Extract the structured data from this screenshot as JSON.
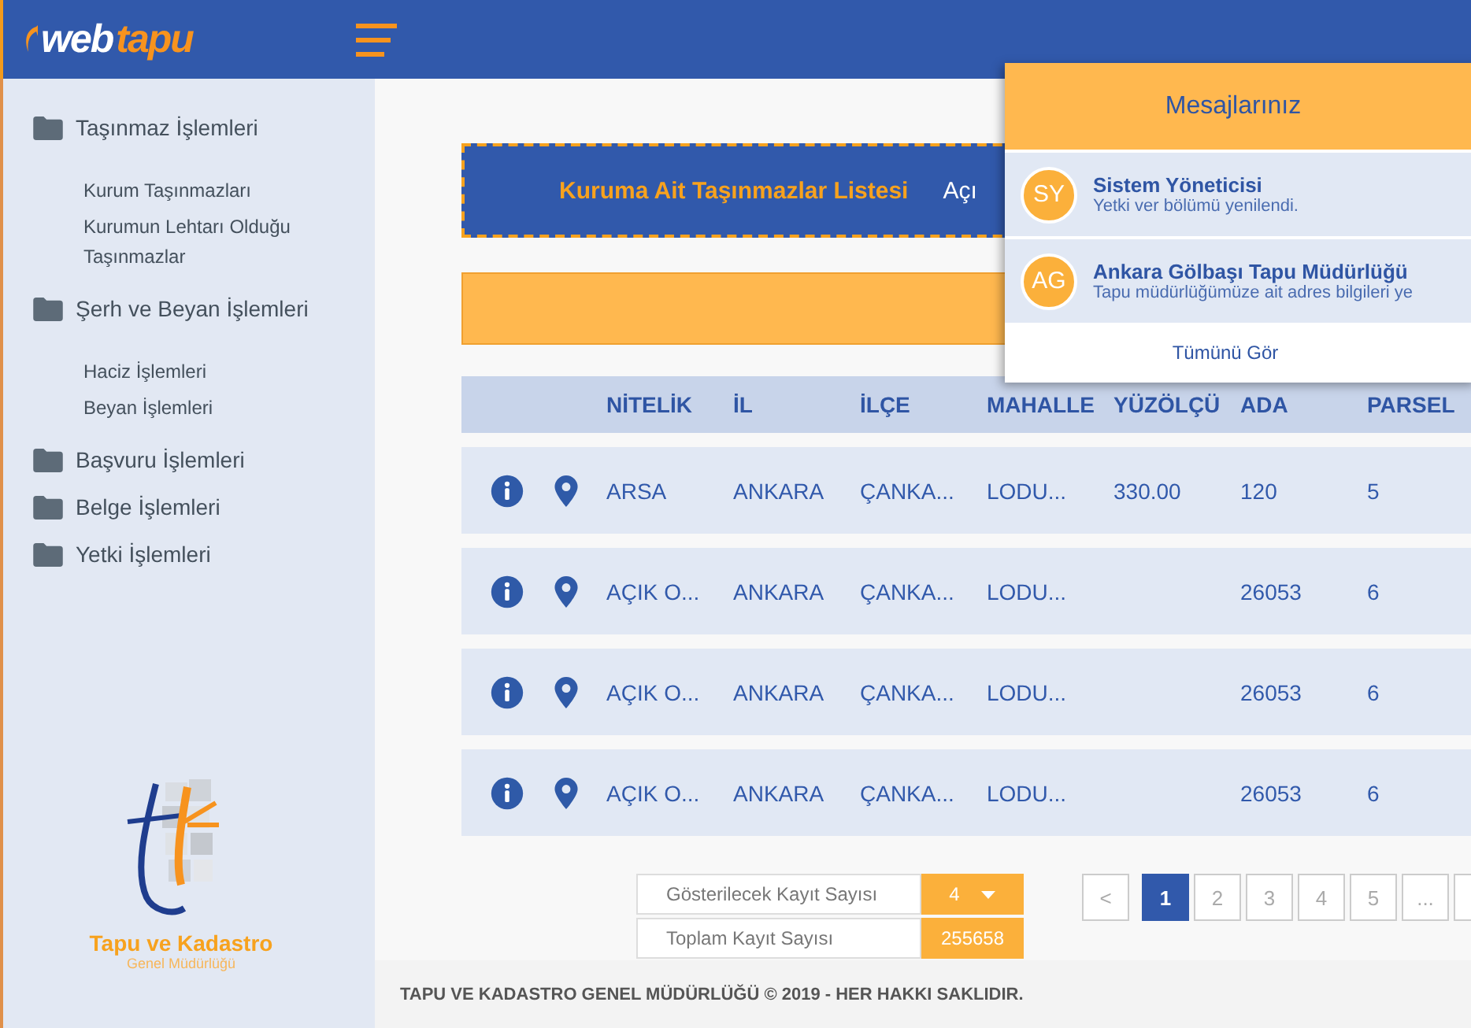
{
  "header": {
    "logo": {
      "part_1": "web",
      "part_2": "tapu"
    }
  },
  "sidebar": {
    "groups": [
      {
        "label": "Taşınmaz İşlemleri",
        "children": [
          {
            "label": "Kurum Taşınmazları"
          },
          {
            "label": "Kurumun Lehtarı Olduğu Taşınmazlar"
          }
        ]
      },
      {
        "label": "Şerh ve Beyan İşlemleri",
        "children": [
          {
            "label": "Haciz İşlemleri"
          },
          {
            "label": "Beyan İşlemleri"
          }
        ]
      },
      {
        "label": "Başvuru İşlemleri"
      },
      {
        "label": "Belge İşlemleri"
      },
      {
        "label": "Yetki İşlemleri"
      }
    ],
    "brand": {
      "title": "Tapu ve Kadastro",
      "subtitle": "Genel Müdürlüğü"
    }
  },
  "banner": {
    "title": "Kuruma Ait Taşınmazlar Listesi",
    "text": "Açı"
  },
  "table": {
    "columns": [
      "NİTELİK",
      "İL",
      "İLÇE",
      "MAHALLE",
      "YÜZÖLÇÜ",
      "ADA",
      "PARSEL"
    ],
    "rows": [
      {
        "cells": [
          "ARSA",
          "ANKARA",
          "ÇANKA...",
          "LODU...",
          "330.00",
          "120",
          "5"
        ]
      },
      {
        "cells": [
          "AÇIK O...",
          "ANKARA",
          "ÇANKA...",
          "LODU...",
          null,
          "26053",
          "6"
        ]
      },
      {
        "cells": [
          "AÇIK O...",
          "ANKARA",
          "ÇANKA...",
          "LODU...",
          null,
          "26053",
          "6"
        ]
      },
      {
        "cells": [
          "AÇIK O...",
          "ANKARA",
          "ÇANKA...",
          "LODU...",
          null,
          "26053",
          "6"
        ]
      }
    ]
  },
  "record_controls": {
    "page_size_label": "Gösterilecek Kayıt Sayısı",
    "page_size": "4",
    "total_label": "Toplam Kayıt Sayısı",
    "total": "255658"
  },
  "pagination": {
    "prev": "<",
    "pages": [
      {
        "label": "1",
        "selected": true
      },
      {
        "label": "2",
        "selected": false
      },
      {
        "label": "3",
        "selected": false
      },
      {
        "label": "4",
        "selected": false
      },
      {
        "label": "5",
        "selected": false
      },
      {
        "label": "...",
        "selected": false
      }
    ]
  },
  "footer": "TAPU VE KADASTRO GENEL MÜDÜRLÜĞÜ © 2019 - HER HAKKI SAKLIDIR.",
  "messages": {
    "title": "Mesajlarınız",
    "items": [
      {
        "initials": "SY",
        "sender": "Sistem Yöneticisi",
        "text": "Yetki ver bölümü yenilendi."
      },
      {
        "initials": "AG",
        "sender": "Ankara Gölbaşı Tapu Müdürlüğü",
        "text": "Tapu müdürlüğümüze ait adres bilgileri ye"
      }
    ],
    "view_all": "Tümünü Gör"
  }
}
